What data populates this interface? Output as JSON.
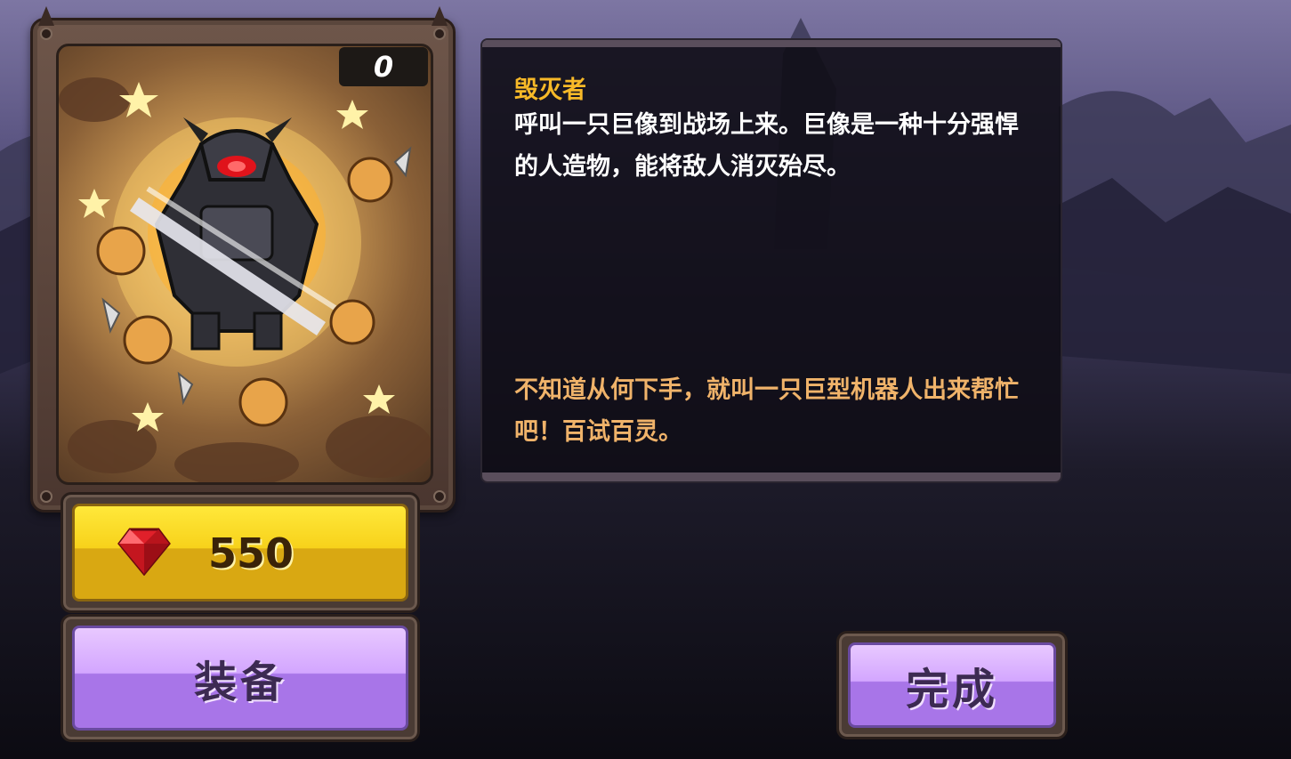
{
  "card": {
    "count": "0",
    "art_icon": "golem-destroyer-illustration"
  },
  "price": {
    "icon": "ruby-gem-icon",
    "value": "550"
  },
  "equip_button": {
    "label": "装备"
  },
  "done_button": {
    "label": "完成"
  },
  "description": {
    "title": "毁灭者",
    "body": "呼叫一只巨像到战场上来。巨像是一种十分强悍的人造物，能将敌人消灭殆尽。",
    "quote": "不知道从何下手，就叫一只巨型机器人出来帮忙吧！百试百灵。"
  },
  "colors": {
    "title": "#f7b928",
    "quote": "#f0b36a",
    "price_button": "#f7d21b",
    "purple_button": "#d3a6ff"
  }
}
